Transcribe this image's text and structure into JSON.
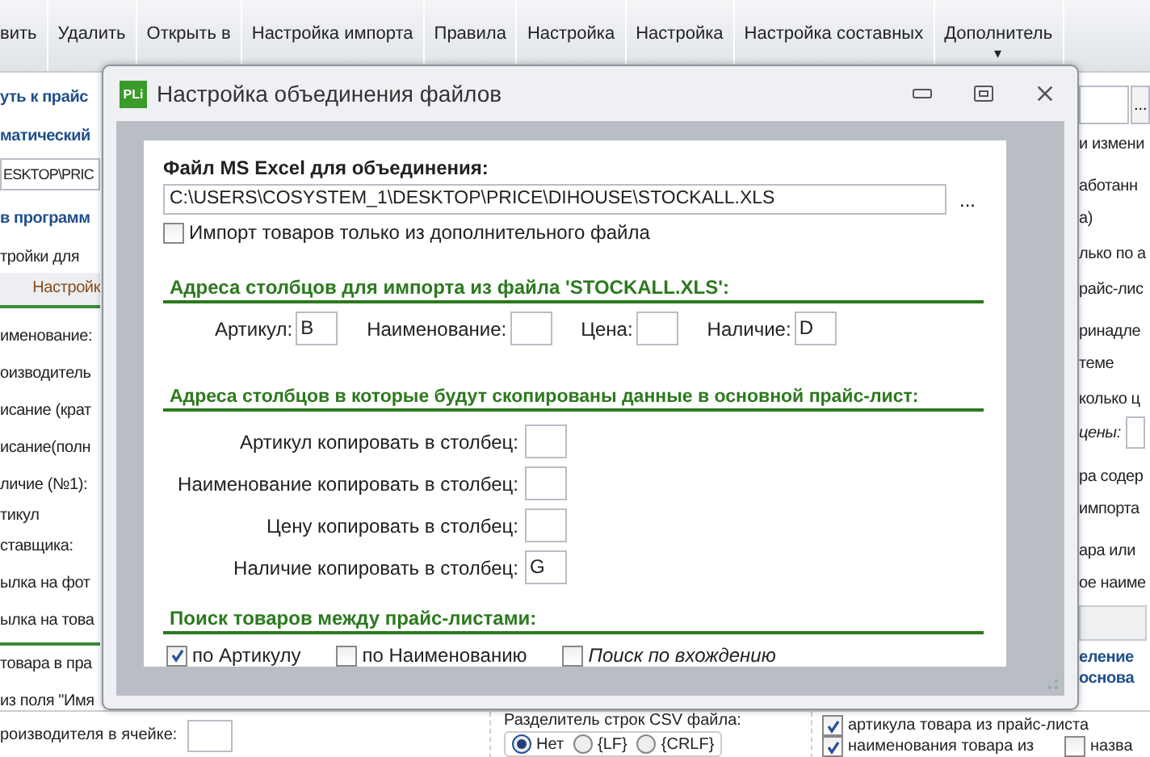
{
  "toolbar": [
    {
      "label": "вить"
    },
    {
      "label": "Удалить"
    },
    {
      "label": "Открыть в"
    },
    {
      "label": "Настройка импорта"
    },
    {
      "label": "Правила"
    },
    {
      "label": "Настройка"
    },
    {
      "label": "Настройка"
    },
    {
      "label": "Настройка составных"
    },
    {
      "label": "Дополнитель",
      "caret": "▾"
    }
  ],
  "left_panel": [
    {
      "kind": "heading",
      "text": "уть к прайс"
    },
    {
      "kind": "heading",
      "text": "матический"
    },
    {
      "kind": "field",
      "text": "ESKTOP\\PRIC"
    },
    {
      "kind": "heading",
      "text": "в программ"
    },
    {
      "kind": "label",
      "text": "тройки для"
    },
    {
      "kind": "tab",
      "text": "Настройк"
    },
    {
      "kind": "label",
      "text": "именование:"
    },
    {
      "kind": "label",
      "text": "оизводитель"
    },
    {
      "kind": "label",
      "text": "исание (крат"
    },
    {
      "kind": "label",
      "text": "исание(полн"
    },
    {
      "kind": "label",
      "text": "личие (№1):"
    },
    {
      "kind": "label2",
      "text": "тикул"
    },
    {
      "kind": "label",
      "text": "ставщика:"
    },
    {
      "kind": "label",
      "text": "ылка на фот"
    },
    {
      "kind": "label",
      "text": "ылка на това"
    },
    {
      "kind": "rule_label",
      "text": "товара в пра"
    },
    {
      "kind": "label",
      "text": "из поля \"Имя"
    }
  ],
  "right_panel": [
    {
      "kind": "browse",
      "text": "..."
    },
    {
      "kind": "label",
      "text": "и измени"
    },
    {
      "kind": "label2",
      "text": "аботанн"
    },
    {
      "kind": "label",
      "text": "а)"
    },
    {
      "kind": "label",
      "text": "лько по а"
    },
    {
      "kind": "label",
      "text": "райс-лис"
    },
    {
      "kind": "label2",
      "text": "ринадле"
    },
    {
      "kind": "label",
      "text": "теме"
    },
    {
      "kind": "label",
      "text": "колько ц"
    },
    {
      "kind": "italic_field",
      "text": "цены:"
    },
    {
      "kind": "label2",
      "text": "ра содер"
    },
    {
      "kind": "label",
      "text": " импорта"
    },
    {
      "kind": "label2",
      "text": "ара или"
    },
    {
      "kind": "label",
      "text": "ое наиме"
    },
    {
      "kind": "gray_field"
    },
    {
      "kind": "heading",
      "text": "еление"
    },
    {
      "kind": "heading2",
      "text": "основа"
    }
  ],
  "bottom": {
    "left_label": "роизводителя в ячейке:",
    "separator_label": "Разделитель строк CSV файла:",
    "radios": [
      {
        "label": "Нет",
        "selected": true
      },
      {
        "label": "{LF}",
        "selected": false
      },
      {
        "label": "{CRLF}",
        "selected": false
      }
    ],
    "checks": [
      {
        "label": "артикула товара из прайс-листа",
        "checked": true
      },
      {
        "label": "наименования товара из",
        "checked": true
      },
      {
        "label": "назва",
        "checked": false
      }
    ]
  },
  "dialog": {
    "app_icon_text": "PLi",
    "title": "Настройка объединения файлов",
    "file_label": "Файл MS Excel для объединения:",
    "file_path": "C:\\USERS\\COSYSTEM_1\\DESKTOP\\PRICE\\DIHOUSE\\STOCKALL.XLS",
    "browse": "...",
    "only_extra": {
      "label": "Импорт товаров только из дополнительного файла",
      "checked": false
    },
    "section1": "Адреса столбцов для импорта из файла 'STOCKALL.XLS':",
    "import_columns": [
      {
        "label": "Артикул:",
        "value": "B"
      },
      {
        "label": "Наименование:"
      },
      {
        "label": "Цена:"
      },
      {
        "label": "Наличие:",
        "value": "D"
      }
    ],
    "section2": "Адреса столбцов в которые будут скопированы данные в основной прайс-лист:",
    "copy_columns": [
      {
        "label": "Артикул копировать в столбец:"
      },
      {
        "label": "Наименование копировать в столбец:"
      },
      {
        "label": "Цену копировать в столбец:"
      },
      {
        "label": "Наличие копировать в столбец:",
        "value": "G"
      }
    ],
    "section3": "Поиск товаров между прайс-листами:",
    "search_options": [
      {
        "label": "по Артикулу",
        "checked": true
      },
      {
        "label": "по Наименованию",
        "checked": false
      },
      {
        "label": "Поиск по вхождению",
        "checked": false,
        "italic": true
      }
    ]
  }
}
